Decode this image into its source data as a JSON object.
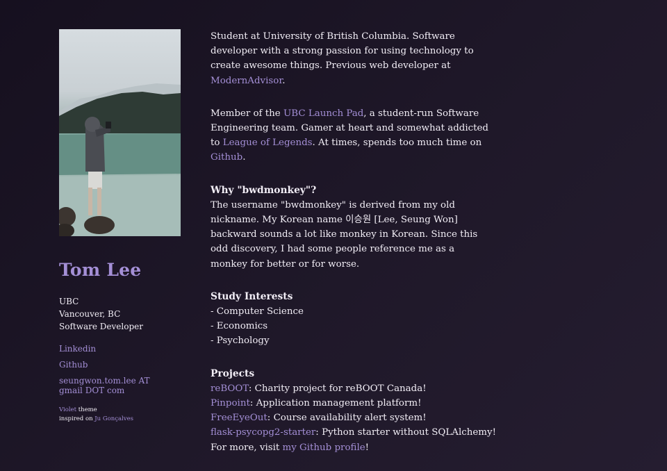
{
  "sidebar": {
    "photo_alt": "",
    "name": "Tom Lee",
    "meta": [
      "UBC",
      "Vancouver, BC",
      "Software Developer"
    ],
    "links": {
      "linkedin": "Linkedin",
      "github": "Github",
      "email": "seungwon.tom.lee AT gmail DOT com"
    },
    "credit": {
      "theme_link": "Violet",
      "theme_text": " theme",
      "inspired_text": "inspired on ",
      "author_link": "Ju Gonçalves"
    }
  },
  "main": {
    "intro": {
      "text": "Student at University of British Columbia. Software developer with a strong passion for using technology to create awesome things. Previous web developer at ",
      "link": "ModernAdvisor",
      "end": "."
    },
    "member": {
      "t1": "Member of the ",
      "link1": "UBC Launch Pad",
      "t2": ", a student-run Software Engineering team. Gamer at heart and somewhat addicted to ",
      "link2": "League of Legends",
      "t3": ". At times, spends too much time on ",
      "link3": "Github",
      "t4": "."
    },
    "why": {
      "heading": "Why \"bwdmonkey\"?",
      "text": "The username \"bwdmonkey\" is derived from my old nickname. My Korean name 이승원 [Lee, Seung Won] backward sounds a lot like monkey in Korean. Since this odd discovery, I had some people reference me as a monkey for better or for worse."
    },
    "study": {
      "heading": "Study Interests",
      "items": [
        "- Computer Science",
        "- Economics",
        "- Psychology"
      ]
    },
    "projects": {
      "heading": "Projects",
      "items": [
        {
          "name": "reBOOT",
          "desc": ": Charity project for reBOOT Canada!"
        },
        {
          "name": "Pinpoint",
          "desc": ": Application management platform!"
        },
        {
          "name": "FreeEyeOut",
          "desc": ": Course availability alert system!"
        },
        {
          "name": "flask-psycopg2-starter",
          "desc": ": Python starter without SQLAlchemy!"
        }
      ],
      "more_text": "For more, visit ",
      "more_link": "my Github profile",
      "more_end": "!"
    }
  },
  "colors": {
    "background": "#1c1526",
    "text": "#f2eef6",
    "accent": "#a48fd6"
  }
}
